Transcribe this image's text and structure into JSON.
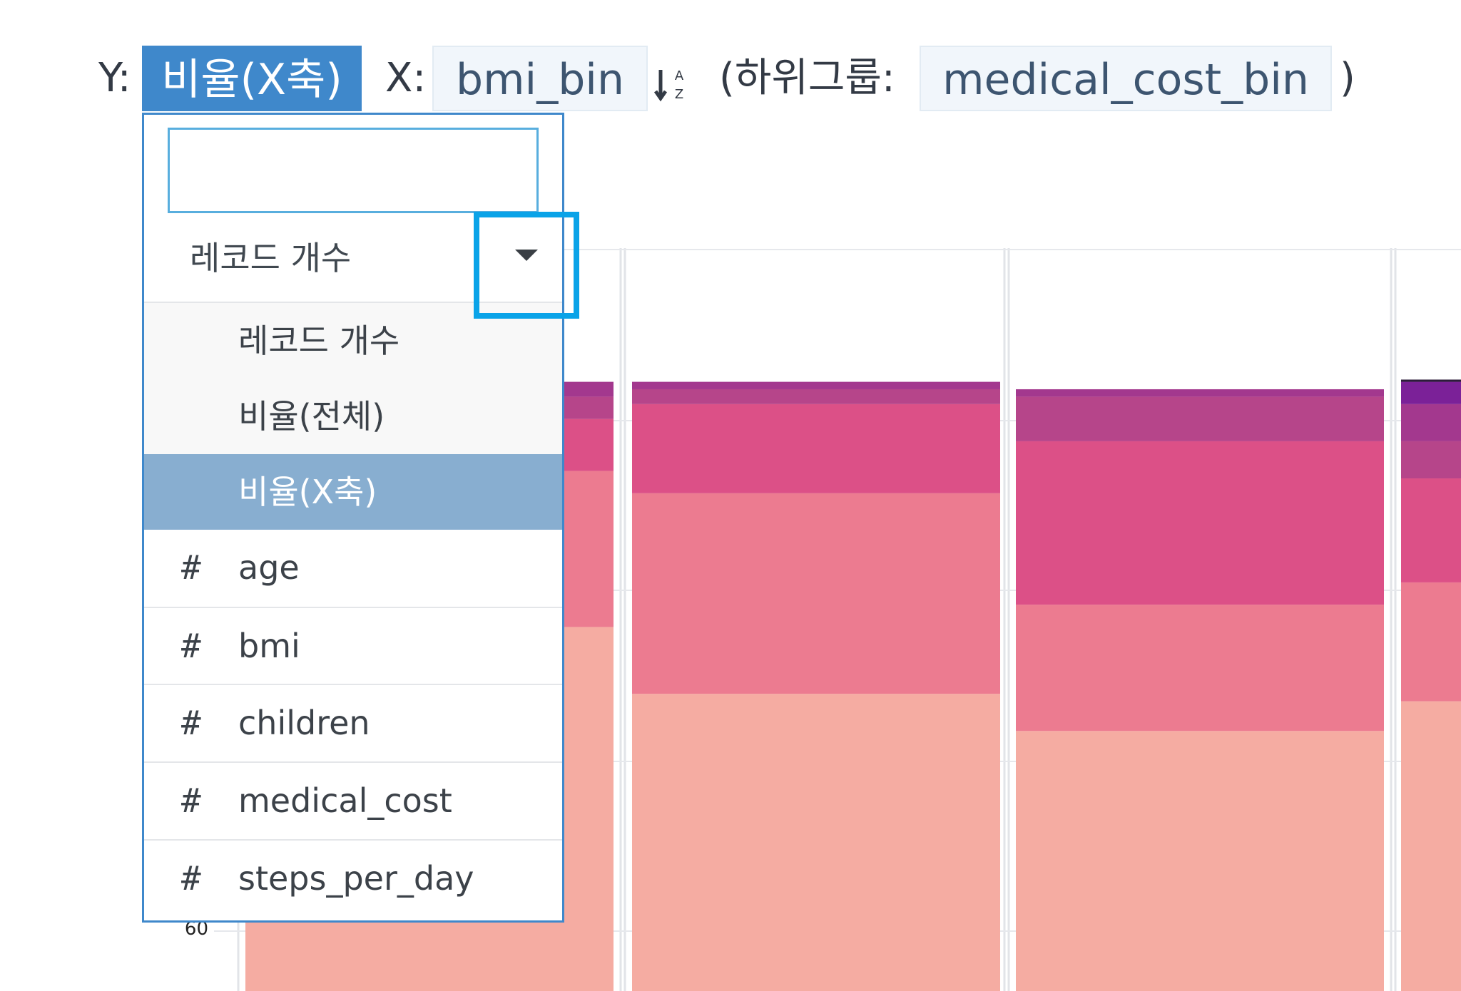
{
  "toolbar": {
    "y_label": "Y:",
    "y_value": "비율(X축)",
    "x_label": "X:",
    "x_value": "bmi_bin",
    "subgroup_prefix": "(하위그룹:",
    "subgroup_value": "medical_cost_bin",
    "subgroup_suffix": ")",
    "sort_icon": "sort-az-icon"
  },
  "dropdown": {
    "search_value": "",
    "selected_label": "레코드 개수",
    "aggregations": [
      {
        "label": "레코드 개수"
      },
      {
        "label": "비율(전체)"
      },
      {
        "label": "비율(X축)",
        "selected": true
      }
    ],
    "fields": [
      {
        "type_symbol": "#",
        "label": "age"
      },
      {
        "type_symbol": "#",
        "label": "bmi"
      },
      {
        "type_symbol": "#",
        "label": "children"
      },
      {
        "type_symbol": "#",
        "label": "medical_cost"
      },
      {
        "type_symbol": "#",
        "label": "steps_per_day"
      }
    ]
  },
  "chart_data": {
    "type": "bar",
    "stacked": true,
    "normalized": true,
    "visible_tick_label": "60",
    "colors": [
      "#f5aca2",
      "#ec7b90",
      "#dc5087",
      "#b6458a",
      "#a3388e",
      "#7b2198",
      "#2c1c3a"
    ],
    "bars": [
      {
        "segments": [
          0.49,
          0.21,
          0.07,
          0.03,
          0.02,
          0.0,
          0.0
        ]
      },
      {
        "segments": [
          0.4,
          0.27,
          0.12,
          0.02,
          0.01,
          0.0,
          0.0
        ]
      },
      {
        "segments": [
          0.35,
          0.17,
          0.22,
          0.06,
          0.01,
          0.0,
          0.0
        ]
      },
      {
        "segments": [
          0.39,
          0.16,
          0.14,
          0.05,
          0.05,
          0.03,
          0.003
        ]
      }
    ]
  }
}
